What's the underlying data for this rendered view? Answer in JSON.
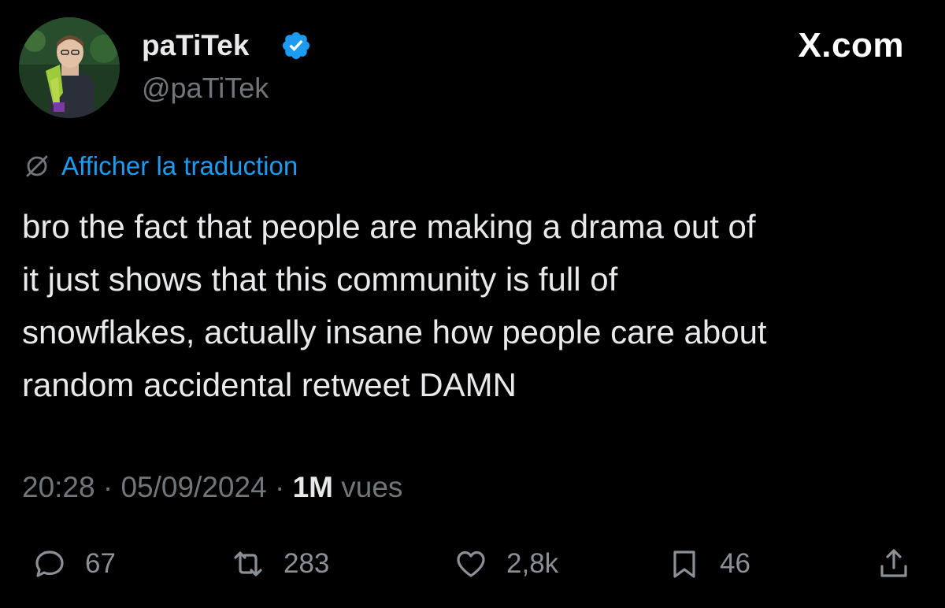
{
  "header": {
    "display_name": "paTiTek",
    "handle": "@paTiTek",
    "site": "X.com"
  },
  "icons": {
    "avatar": "avatar",
    "verified": "verified-badge-icon",
    "translate": "globe-icon",
    "reply": "reply-bubble-icon",
    "retweet": "retweet-icon",
    "like": "heart-icon",
    "bookmark": "bookmark-icon",
    "share": "share-icon"
  },
  "colors": {
    "background": "#000000",
    "text": "#e7e9ea",
    "muted": "#71767b",
    "link": "#1d9bf0",
    "verified": "#1d9bf0"
  },
  "tweet": {
    "translate_label": "Afficher la traduction",
    "text": "bro the fact that people are making a drama out of\nit just shows that this community is full of\nsnowflakes, actually insane how people care about\nrandom accidental retweet DAMN"
  },
  "meta": {
    "time": "20:28",
    "separator": "·",
    "date": "05/09/2024",
    "views_count": "1M",
    "views_label": "vues"
  },
  "actions": {
    "replies": "67",
    "retweets": "283",
    "likes": "2,8k",
    "bookmarks": "46"
  }
}
